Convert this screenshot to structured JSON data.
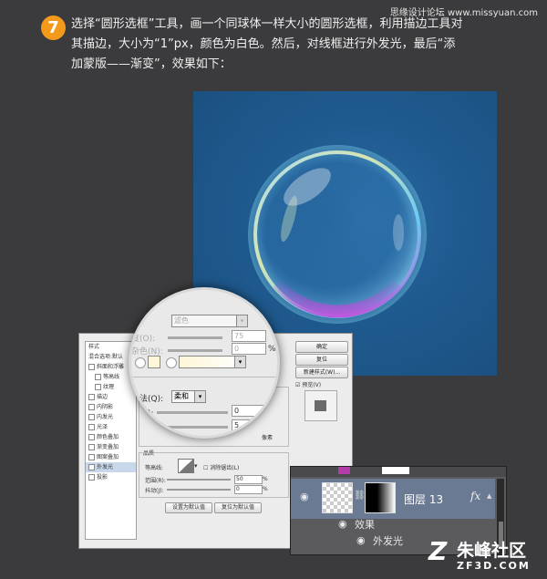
{
  "watermark": "思缘设计论坛 www.missyuan.com",
  "step": {
    "number": "7"
  },
  "instruction": {
    "line1": "选择“圆形选框”工具，画一个同球体一样大小的圆形选框，利用描边工具对",
    "line2": "其描边，大小为“1”px，颜色为白色。然后，对线框进行外发光，最后“添",
    "line3": "加蒙版——渐变”，效果如下："
  },
  "dialog": {
    "sidebar_items": [
      {
        "label": "样式",
        "checkbox": false,
        "indent": false,
        "active": false
      },
      {
        "label": "混合选项:默认",
        "checkbox": false,
        "indent": false,
        "active": false
      },
      {
        "label": "斜面和浮雕",
        "checkbox": true,
        "indent": false,
        "active": false
      },
      {
        "label": "等高线",
        "checkbox": true,
        "indent": true,
        "active": false
      },
      {
        "label": "纹理",
        "checkbox": true,
        "indent": true,
        "active": false
      },
      {
        "label": "描边",
        "checkbox": true,
        "indent": false,
        "active": false
      },
      {
        "label": "内阴影",
        "checkbox": true,
        "indent": false,
        "active": false
      },
      {
        "label": "内发光",
        "checkbox": true,
        "indent": false,
        "active": false
      },
      {
        "label": "光泽",
        "checkbox": true,
        "indent": false,
        "active": false
      },
      {
        "label": "颜色叠加",
        "checkbox": true,
        "indent": false,
        "active": false
      },
      {
        "label": "渐变叠加",
        "checkbox": true,
        "indent": false,
        "active": false
      },
      {
        "label": "图案叠加",
        "checkbox": true,
        "indent": false,
        "active": false
      },
      {
        "label": "外发光",
        "checkbox": true,
        "indent": false,
        "active": true
      },
      {
        "label": "投影",
        "checkbox": true,
        "indent": false,
        "active": false
      }
    ],
    "ok_label": "确定",
    "reset_label": "复位",
    "new_style_label": "新建样式(W)...",
    "preview_label": "预览(V)",
    "elements_label": "图素",
    "px_unit": "像素",
    "quality_label": "品质",
    "contour_label": "等高线:",
    "antialias_label": "消除锯齿(L)",
    "range_label": "范围(R):",
    "range_value": "50",
    "jitter_label": "抖动(J):",
    "jitter_value": "0",
    "percent": "%",
    "make_default_label": "设置为默认值",
    "reset_default_label": "复位为默认值"
  },
  "magnifier": {
    "blend_value": "滤色",
    "opacity_label": "度(O):",
    "opacity_value": "75",
    "noise_label": "杂色(N):",
    "noise_value": "0",
    "percent": "%",
    "method_label": "方法(Q):",
    "method_value": "柔和",
    "spread_label": "展(P):",
    "spread_value": "0",
    "size_label": "大小(S):",
    "size_value": "5",
    "px_suffix": "像素"
  },
  "layers_panel": {
    "layer_name": "图层 13",
    "fx_label": "fx",
    "effects_label": "效果",
    "outer_glow_label": "外发光"
  },
  "logo": {
    "name": "朱峰社区",
    "domain": "ZF3D.COM"
  },
  "colors": {
    "background": "#3b3b3d",
    "badge": "#f39a1b",
    "canvas_blue": "#1f5a8f",
    "layer_selected": "#6a7a93"
  }
}
